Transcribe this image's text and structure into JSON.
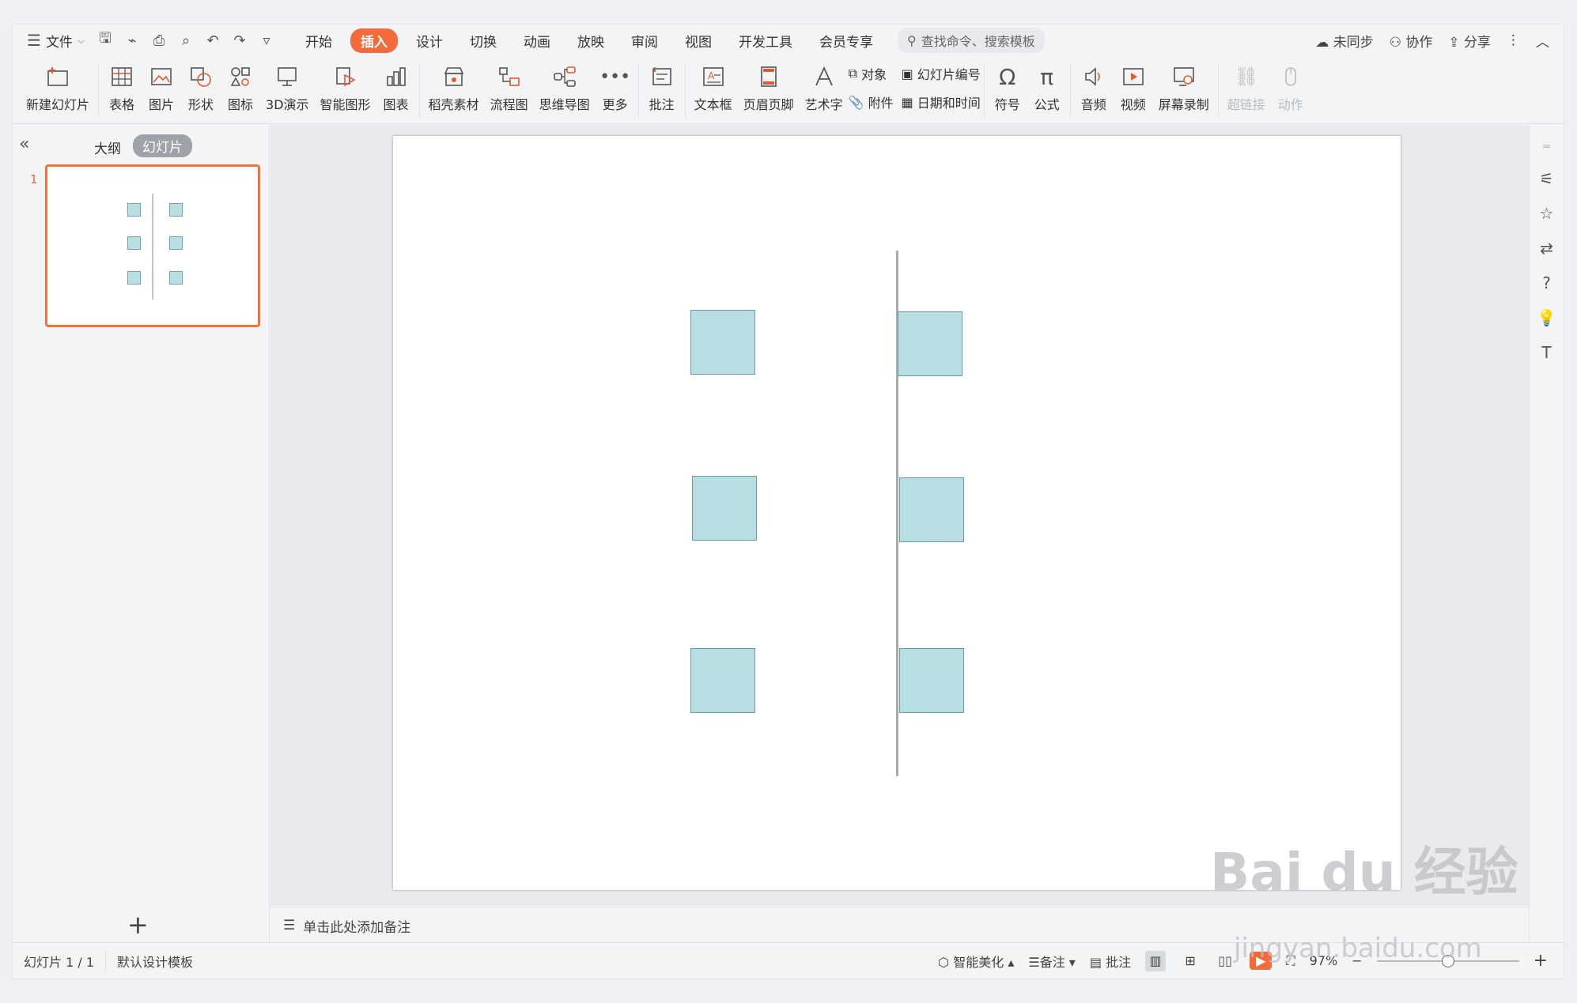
{
  "menu": {
    "file_label": "文件",
    "tabs": [
      "开始",
      "插入",
      "设计",
      "切换",
      "动画",
      "放映",
      "审阅",
      "视图",
      "开发工具",
      "会员专享"
    ],
    "active_tab": "插入",
    "search_placeholder": "查找命令、搜索模板",
    "sync_label": "未同步",
    "collab_label": "协作",
    "share_label": "分享"
  },
  "ribbon": {
    "new_slide": "新建幻灯片",
    "table": "表格",
    "picture": "图片",
    "shape": "形状",
    "icon": "图标",
    "3d": "3D演示",
    "smartart": "智能图形",
    "chart": "图表",
    "material": "稻壳素材",
    "flowchart": "流程图",
    "mindmap": "思维导图",
    "more": "更多",
    "comment": "批注",
    "textbox": "文本框",
    "header_footer": "页眉页脚",
    "wordart": "艺术字",
    "object": "对象",
    "slide_number": "幻灯片编号",
    "attachment": "附件",
    "datetime": "日期和时间",
    "symbol": "符号",
    "formula": "公式",
    "audio": "音频",
    "video": "视频",
    "screen_record": "屏幕录制",
    "hyperlink": "超链接",
    "action": "动作"
  },
  "left_panel": {
    "tab_outline": "大纲",
    "tab_slides": "幻灯片",
    "slide_number": "1"
  },
  "notes_placeholder": "单击此处添加备注",
  "status": {
    "slide_count": "幻灯片 1 / 1",
    "template": "默认设计模板",
    "beautify": "智能美化",
    "notes": "备注",
    "comments": "批注",
    "zoom": "97%"
  },
  "watermark": {
    "brand": "Bai du 经验",
    "url": "jingyan.baidu.com"
  }
}
